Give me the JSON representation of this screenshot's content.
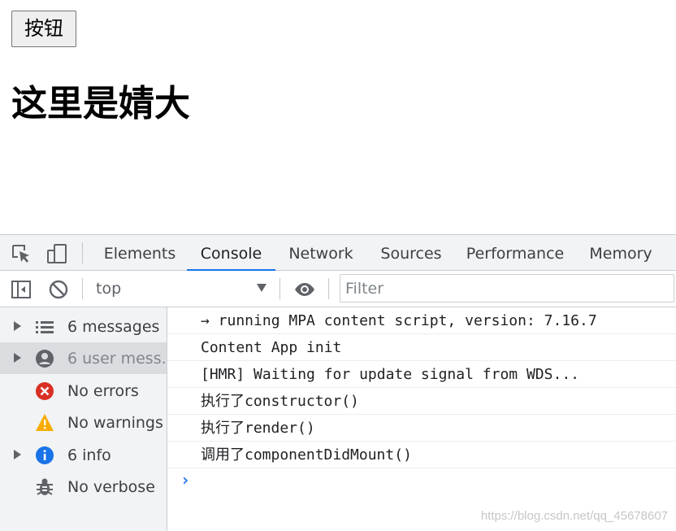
{
  "page": {
    "button_label": "按钮",
    "heading": "这里是婧大"
  },
  "devtools": {
    "tabs": [
      {
        "label": "Elements"
      },
      {
        "label": "Console",
        "active": true
      },
      {
        "label": "Network"
      },
      {
        "label": "Sources"
      },
      {
        "label": "Performance"
      },
      {
        "label": "Memory"
      }
    ],
    "toolbar": {
      "context": "top",
      "filter_placeholder": "Filter"
    },
    "sidebar": [
      {
        "label": "6 messages",
        "icon": "list-icon"
      },
      {
        "label": "6 user mess...",
        "icon": "user-icon",
        "selected": true
      },
      {
        "label": "No errors",
        "icon": "error-icon"
      },
      {
        "label": "No warnings",
        "icon": "warning-icon"
      },
      {
        "label": "6 info",
        "icon": "info-icon"
      },
      {
        "label": "No verbose",
        "icon": "bug-icon"
      }
    ],
    "console_messages": [
      "→ running MPA content script, version: 7.16.7",
      "Content App init",
      "[HMR] Waiting for update signal from WDS...",
      "执行了constructor()",
      "执行了render()",
      "调用了componentDidMount()"
    ],
    "prompt": "›"
  },
  "watermark": "https://blog.csdn.net/qq_45678607",
  "colors": {
    "accent": "#1a73e8",
    "error": "#d93025",
    "warning": "#f9ab00",
    "info": "#1a73e8"
  }
}
